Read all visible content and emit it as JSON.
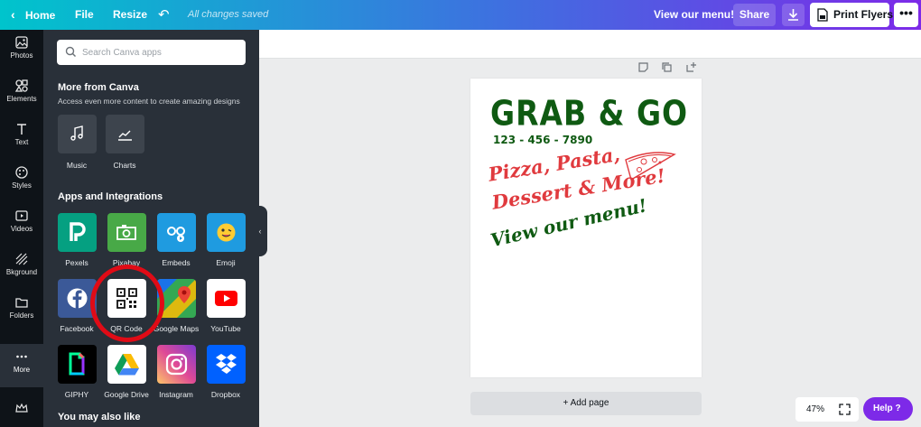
{
  "topbar": {
    "home": "Home",
    "file": "File",
    "resize": "Resize",
    "saved": "All changes saved",
    "design_title": "View our menu!",
    "share": "Share",
    "print": "Print Flyers",
    "more": "•••"
  },
  "rail": {
    "items": [
      {
        "label": "Photos",
        "icon": "photos-icon"
      },
      {
        "label": "Elements",
        "icon": "elements-icon"
      },
      {
        "label": "Text",
        "icon": "text-icon"
      },
      {
        "label": "Styles",
        "icon": "styles-icon"
      },
      {
        "label": "Videos",
        "icon": "videos-icon"
      },
      {
        "label": "Bkground",
        "icon": "background-icon"
      },
      {
        "label": "Folders",
        "icon": "folders-icon"
      },
      {
        "label": "More",
        "icon": "more-icon"
      }
    ]
  },
  "panel": {
    "search_placeholder": "Search Canva apps",
    "more_from_canva": "More from Canva",
    "more_from_canva_sub": "Access even more content to create amazing designs",
    "canva_items": [
      {
        "label": "Music",
        "icon": "music-icon"
      },
      {
        "label": "Charts",
        "icon": "charts-icon"
      }
    ],
    "apps_heading": "Apps and Integrations",
    "apps": [
      {
        "label": "Pexels",
        "icon": "pexels-icon",
        "color": "#05a081"
      },
      {
        "label": "Pixabay",
        "icon": "pixabay-icon",
        "color": "#48a947"
      },
      {
        "label": "Embeds",
        "icon": "embeds-icon",
        "color": "#1f9be0"
      },
      {
        "label": "Emoji",
        "icon": "emoji-icon",
        "color": "#1f9be0"
      },
      {
        "label": "Facebook",
        "icon": "facebook-icon",
        "color": "#3b5998"
      },
      {
        "label": "QR Code",
        "icon": "qr-code-icon",
        "color": "#ffffff"
      },
      {
        "label": "Google Maps",
        "icon": "google-maps-icon",
        "color": "#34a853"
      },
      {
        "label": "YouTube",
        "icon": "youtube-icon",
        "color": "#ffffff"
      },
      {
        "label": "GIPHY",
        "icon": "giphy-icon",
        "color": "#000000"
      },
      {
        "label": "Google Drive",
        "icon": "google-drive-icon",
        "color": "#ffffff"
      },
      {
        "label": "Instagram",
        "icon": "instagram-icon",
        "color": "#d6249f"
      },
      {
        "label": "Dropbox",
        "icon": "dropbox-icon",
        "color": "#0061ff"
      }
    ],
    "also_like": "You may also like"
  },
  "design": {
    "headline": "GRAB & GO",
    "phone": "123 - 456 - 7890",
    "line1": "Pizza, Pasta,",
    "line2": "Dessert & More!",
    "line3": "View our menu!",
    "green": "#0f5a12",
    "red": "#e03a3e"
  },
  "canvas": {
    "add_page": "+ Add page",
    "zoom": "47%",
    "help": "Help ?"
  }
}
